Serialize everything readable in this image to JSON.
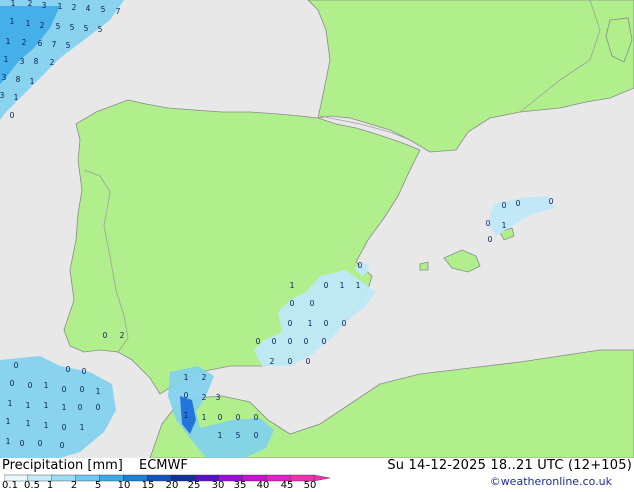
{
  "map": {
    "region": "Iberian Peninsula and western Mediterranean",
    "colors": {
      "sea": "#e8e8e8",
      "land": "#b0ef8c",
      "coast": "#8a8a8a",
      "border": "#a0a0a0",
      "precip_light": "#bfe8f8",
      "precip_mid": "#7fd0f0",
      "precip_heavy": "#38a8e8",
      "precip_strong": "#1a6ad8"
    },
    "value_labels": [
      "1",
      "2",
      "3",
      "1",
      "2",
      "4",
      "5",
      "7",
      "1",
      "1",
      "2",
      "5",
      "5",
      "5",
      "5",
      "1",
      "2",
      "6",
      "7",
      "5",
      "1",
      "3",
      "8",
      "2",
      "3",
      "8",
      "1",
      "3",
      "1",
      "0",
      "0",
      "0",
      "0",
      "0",
      "1",
      "0",
      "0",
      "0",
      "1",
      "1",
      "1",
      "0",
      "0",
      "0",
      "1",
      "0",
      "0",
      "0",
      "0",
      "0",
      "0",
      "0",
      "2",
      "0",
      "0",
      "0",
      "2",
      "0",
      "0",
      "0",
      "0",
      "0",
      "1",
      "0",
      "0",
      "1",
      "1",
      "1",
      "1",
      "1",
      "0",
      "0",
      "1",
      "1",
      "1",
      "0",
      "1",
      "1",
      "0",
      "0",
      "0",
      "1",
      "2",
      "0",
      "2",
      "3",
      "1",
      "1",
      "0",
      "0",
      "0",
      "1",
      "5",
      "0",
      "1",
      "2"
    ]
  },
  "legend": {
    "title": "Precipitation [mm]",
    "model": "ECMWF",
    "date": "Su 14-12-2025 18..21 UTC (12+105)",
    "credit": "©weatheronline.co.uk",
    "scale_labels": [
      "0.1",
      "0.5",
      "1",
      "2",
      "5",
      "10",
      "15",
      "20",
      "25",
      "30",
      "35",
      "40",
      "45",
      "50"
    ],
    "scale_colors": [
      "#e8f8ff",
      "#c4ecfa",
      "#9adcf5",
      "#6ec8f0",
      "#3aaae6",
      "#1a80d8",
      "#1652c0",
      "#1030a0",
      "#5a10c8",
      "#9a10d8",
      "#c810d8",
      "#e020c8",
      "#f030b0"
    ]
  }
}
